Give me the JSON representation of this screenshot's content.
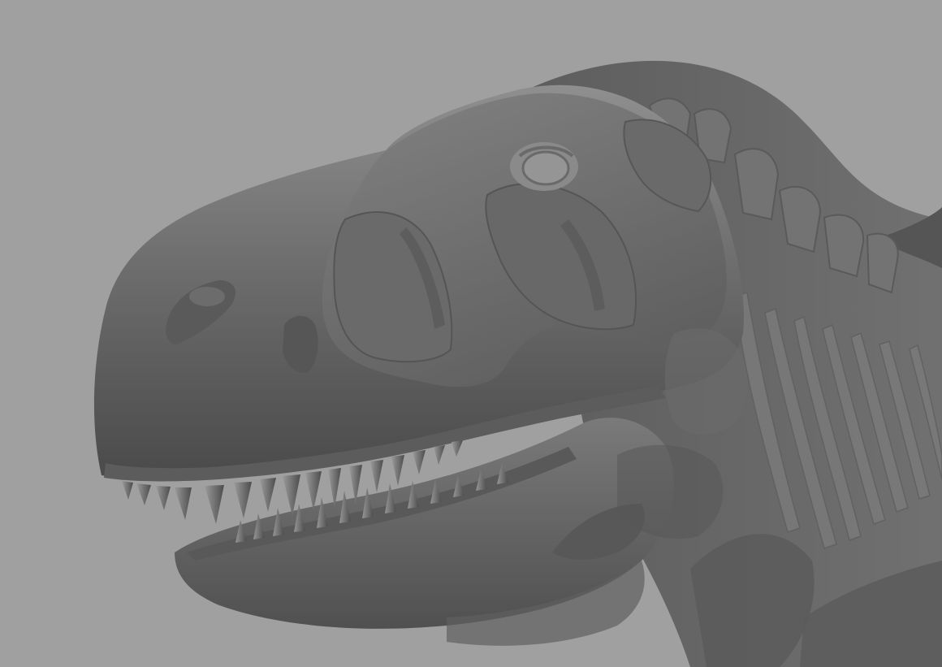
{
  "viewport": {
    "background_color": "#a0a0a0",
    "model_color": "#666666",
    "model_highlight": "#8a8a8a",
    "model_shadow": "#454545",
    "render_style": "semi-transparent grey shaded 3D model",
    "subject_icon": "dinosaur-skull-icon"
  }
}
